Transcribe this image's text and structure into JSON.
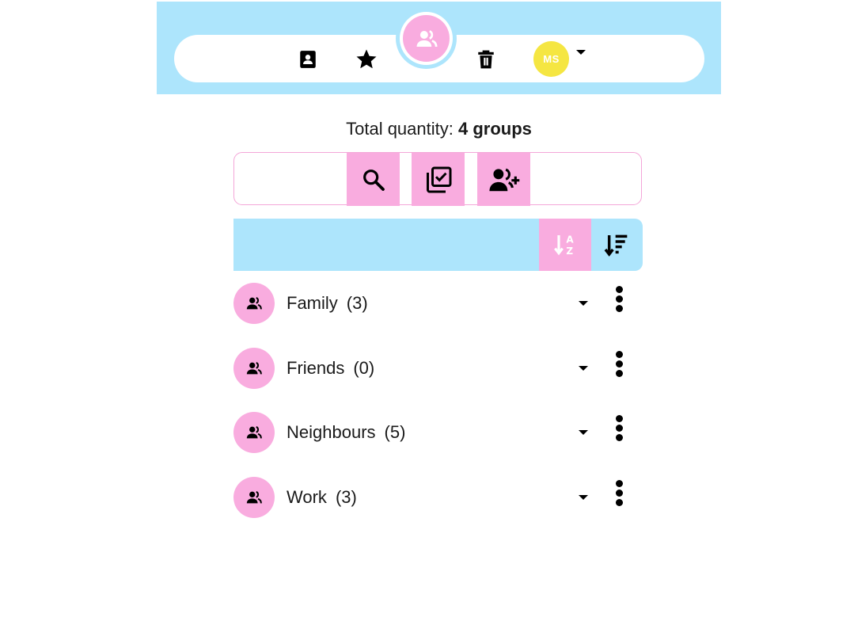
{
  "header": {
    "user_initials": "MS"
  },
  "summary": {
    "prefix": "Total quantity:",
    "value": "4 groups"
  },
  "toolbar": {
    "search": "search-icon",
    "select": "select-all-icon",
    "add": "add-group-icon"
  },
  "groups": [
    {
      "name": "Family",
      "count": "(3)"
    },
    {
      "name": "Friends",
      "count": "(0)"
    },
    {
      "name": "Neighbours",
      "count": "(5)"
    },
    {
      "name": "Work",
      "count": "(3)"
    }
  ],
  "colors": {
    "accent_blue": "#ade5fc",
    "accent_pink": "#f9acdf",
    "avatar_yellow": "#f5e642"
  }
}
